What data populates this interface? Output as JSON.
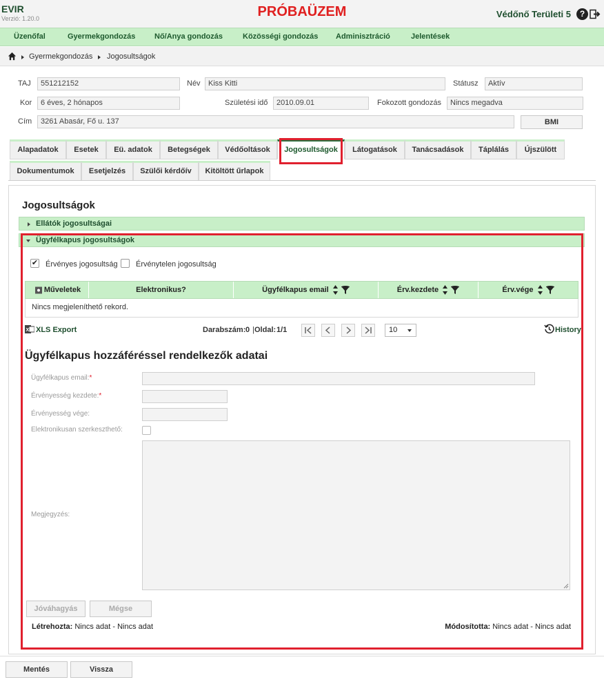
{
  "header": {
    "app_title": "EVIR",
    "version": "Verzió: 1.20.0",
    "environment": "PRÓBAÜZEM",
    "user": "Védőnő Területi 5",
    "help_glyph": "?"
  },
  "nav": {
    "items": [
      "Üzenőfal",
      "Gyermekgondozás",
      "Nő/Anya gondozás",
      "Közösségi gondozás",
      "Adminisztráció",
      "Jelentések"
    ]
  },
  "breadcrumb": [
    "Gyermekgondozás",
    "Jogosultságok"
  ],
  "patient": {
    "taj_label": "TAJ",
    "taj": "551212152",
    "nev_label": "Név",
    "nev": "Kiss Kitti",
    "statusz_label": "Státusz",
    "statusz": "Aktív",
    "kor_label": "Kor",
    "kor": "6 éves, 2 hónapos",
    "szul_label": "Születési idő",
    "szul": "2010.09.01",
    "fokozott_label": "Fokozott gondozás",
    "fokozott": "Nincs megadva",
    "cim_label": "Cím",
    "cim": "3261 Abasár, Fő u. 137",
    "bmi_button": "BMI"
  },
  "tabs": {
    "row1": [
      "Alapadatok",
      "Esetek",
      "Eü. adatok",
      "Betegségek",
      "Védőoltások",
      "Jogosultságok",
      "Látogatások",
      "Tanácsadások",
      "Táplálás",
      "Újszülött"
    ],
    "row2": [
      "Dokumentumok",
      "Esetjelzés",
      "Szülői kérdőív",
      "Kitöltött űrlapok"
    ],
    "active": "Jogosultságok"
  },
  "section": {
    "title": "Jogosultságok",
    "acc1": "Ellátók jogosultságai",
    "acc2": "Ügyfélkapus jogosultságok"
  },
  "filters": {
    "valid_label": "Érvényes jogosultság",
    "valid_checked": true,
    "invalid_label": "Érvénytelen jogosultság",
    "invalid_checked": false,
    "check_glyph": "✔"
  },
  "grid": {
    "columns": [
      "Műveletek",
      "Elektronikus?",
      "Ügyfélkapus email",
      "Érv.kezdete",
      "Érv.vége"
    ],
    "empty_text": "Nincs megjeleníthető rekord."
  },
  "pager": {
    "export_label": "XLS Export",
    "count_label": "Darabszám:",
    "count": "0",
    "page_label": "Oldal:",
    "page": "1/1",
    "page_size": "10",
    "history_label": "History"
  },
  "form": {
    "title": "Ügyfélkapus hozzáféréssel rendelkezők adatai",
    "email_label": "Ügyfélkapus email:",
    "start_label": "Érvényesség kezdete:",
    "end_label": "Érvényesség vége:",
    "editable_label": "Elektronikusan szerkeszthető:",
    "note_label": "Megjegyzés:",
    "approve_button": "Jóváhagyás",
    "cancel_button": "Mégse",
    "required_mark": "*",
    "created_label": "Létrehozta:",
    "created_value": "Nincs adat - Nincs adat",
    "modified_label": "Módosította:",
    "modified_value": "Nincs adat - Nincs adat"
  },
  "footer": {
    "save_button": "Mentés",
    "back_button": "Vissza"
  },
  "colors": {
    "brand_green": "#c8efc8",
    "dark_green": "#1e4e2e",
    "alert_red": "#e0202e"
  },
  "icons": [
    "home-icon",
    "help-icon",
    "logout-icon",
    "gear-icon",
    "sort-icon",
    "filter-icon",
    "xls-icon",
    "first-page-icon",
    "prev-page-icon",
    "next-page-icon",
    "last-page-icon",
    "history-icon"
  ]
}
